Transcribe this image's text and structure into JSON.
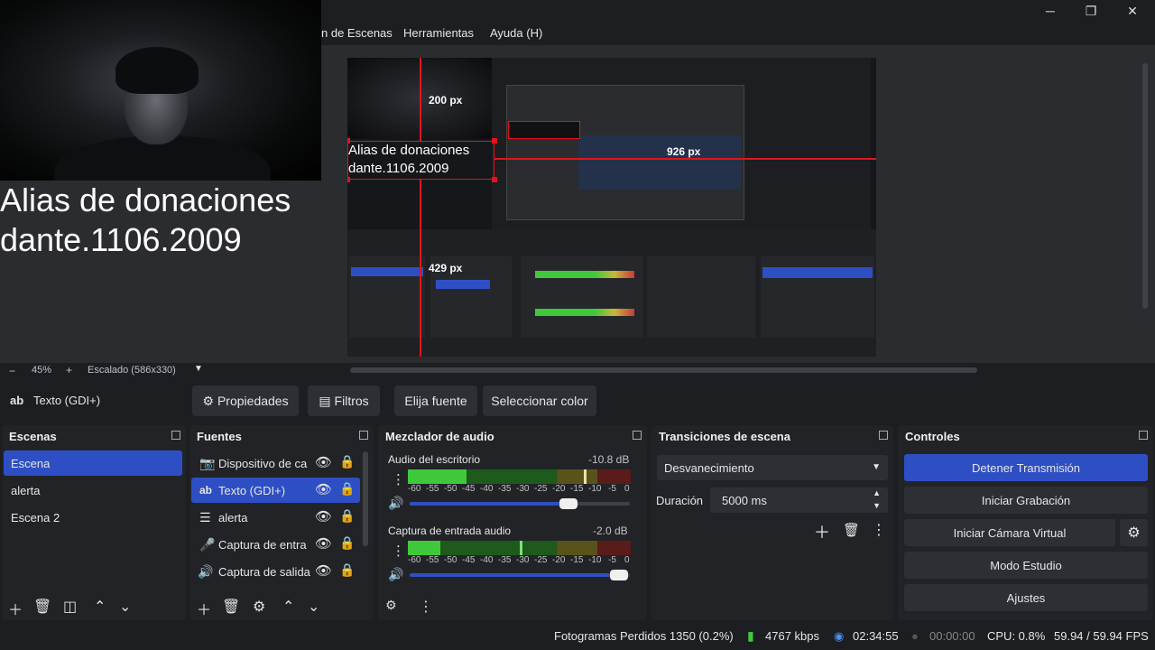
{
  "window": {
    "min": "─",
    "max": "❐",
    "close": "✕"
  },
  "menu": {
    "items": [
      "n de Escenas",
      "Herramientas",
      "Ayuda (H)"
    ]
  },
  "overlay_text": {
    "line1": "Alias de donaciones",
    "line2": "dante.1106.2009"
  },
  "preview": {
    "text_line1": "Alias de donaciones",
    "text_line2": "dante.1106.2009",
    "guide_top": "200 px",
    "guide_right": "926 px",
    "guide_bottom": "429 px"
  },
  "zoombar": {
    "minus": "−",
    "zoom": "45%",
    "plus": "+",
    "scale": "Escalado (586x330)"
  },
  "source_toolbar": {
    "source_name": "Texto (GDI+)",
    "properties": "Propiedades",
    "filters": "Filtros",
    "choose_font": "Elija fuente",
    "select_color": "Seleccionar color"
  },
  "scenes": {
    "title": "Escenas",
    "items": [
      "Escena",
      "alerta",
      "Escena 2"
    ]
  },
  "sources": {
    "title": "Fuentes",
    "items": [
      "Dispositivo de ca",
      "Texto (GDI+)",
      "alerta",
      "Captura de entra",
      "Captura de salida"
    ]
  },
  "mixer": {
    "title": "Mezclador de audio",
    "ch1_name": "Audio del escritorio",
    "ch1_db": "-10.8 dB",
    "ch1_volume": 0.72,
    "ch2_name": "Captura de entrada audio",
    "ch2_db": "-2.0 dB",
    "ch2_volume": 0.95,
    "scale": [
      "-60",
      "-55",
      "-50",
      "-45",
      "-40",
      "-35",
      "-30",
      "-25",
      "-20",
      "-15",
      "-10",
      "-5",
      "0"
    ]
  },
  "transitions": {
    "title": "Transiciones de escena",
    "selected": "Desvanecimiento",
    "duration_label": "Duración",
    "duration_value": "5000 ms"
  },
  "controls": {
    "title": "Controles",
    "stop_stream": "Detener Transmisión",
    "start_recording": "Iniciar Grabación",
    "start_virtual_cam": "Iniciar Cámara Virtual",
    "studio_mode": "Modo Estudio",
    "settings": "Ajustes"
  },
  "status": {
    "dropped_frames": "Fotogramas Perdidos 1350 (0.2%)",
    "bitrate": "4767 kbps",
    "stream_time": "02:34:55",
    "rec_time": "00:00:00",
    "cpu": "CPU: 0.8%",
    "fps": "59.94 / 59.94 FPS"
  },
  "colors": {
    "accent": "#2e4fc4",
    "guide": "#e0141e",
    "meter_green": "#3fc93a",
    "meter_yellow": "#c9b83a",
    "meter_red": "#c93a3a"
  }
}
